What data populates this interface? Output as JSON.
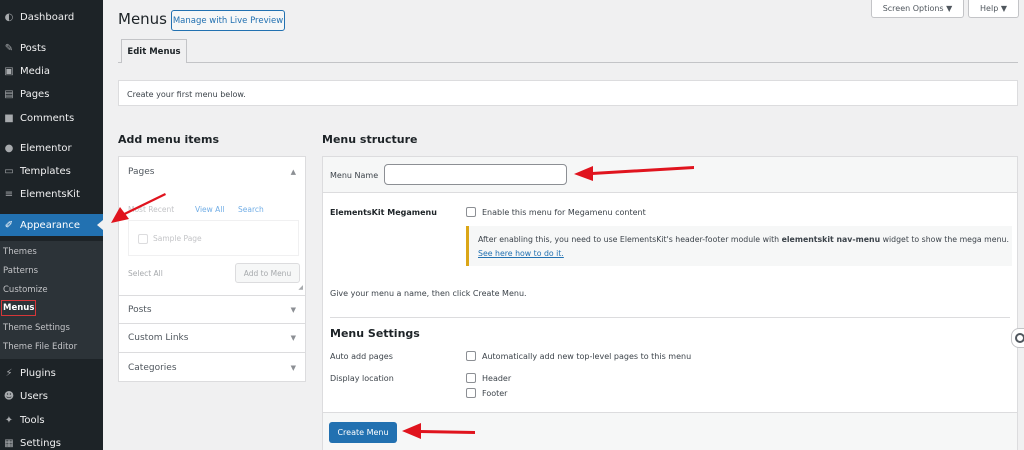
{
  "sidebar": {
    "items": [
      {
        "label": "Dashboard",
        "icon": "dashboard-icon"
      },
      {
        "label": "Posts",
        "icon": "pin-icon"
      },
      {
        "label": "Media",
        "icon": "media-icon"
      },
      {
        "label": "Pages",
        "icon": "pages-icon"
      },
      {
        "label": "Comments",
        "icon": "comments-icon"
      },
      {
        "label": "Elementor",
        "icon": "elementor-icon"
      },
      {
        "label": "Templates",
        "icon": "folder-icon"
      },
      {
        "label": "ElementsKit",
        "icon": "elementskit-icon"
      },
      {
        "label": "Appearance",
        "icon": "brush-icon"
      },
      {
        "label": "Plugins",
        "icon": "plugin-icon"
      },
      {
        "label": "Users",
        "icon": "user-icon"
      },
      {
        "label": "Tools",
        "icon": "wrench-icon"
      },
      {
        "label": "Settings",
        "icon": "settings-icon"
      }
    ],
    "submenu": [
      "Themes",
      "Patterns",
      "Customize",
      "Menus",
      "Theme Settings",
      "Theme File Editor"
    ]
  },
  "header": {
    "title": "Menus",
    "live_preview": "Manage with Live Preview",
    "screen_options": "Screen Options ▼",
    "help": "Help ▼",
    "tab": "Edit Menus"
  },
  "notice": "Create your first menu below.",
  "add_items": {
    "heading": "Add menu items",
    "pages": "Pages",
    "tabs": [
      "Most Recent",
      "View All",
      "Search"
    ],
    "sample_page": "Sample Page",
    "select_all": "Select All",
    "add_to_menu": "Add to Menu",
    "posts": "Posts",
    "custom_links": "Custom Links",
    "categories": "Categories"
  },
  "structure": {
    "heading": "Menu structure",
    "menu_name_label": "Menu Name",
    "menu_name_value": "",
    "megamenu_label": "ElementsKit Megamenu",
    "megamenu_option": "Enable this menu for Megamenu content",
    "info_pre": "After enabling this, you need to use ElementsKit's header-footer module with ",
    "info_bold": "elementskit nav-menu",
    "info_post": " widget to show the mega menu.",
    "info_link": "See here how to do it.",
    "hint": "Give your menu a name, then click Create Menu.",
    "settings_heading": "Menu Settings",
    "auto_add_label": "Auto add pages",
    "auto_add_option": "Automatically add new top-level pages to this menu",
    "display_location_label": "Display location",
    "locations": [
      "Header",
      "Footer"
    ],
    "create_button": "Create Menu"
  },
  "colors": {
    "sidebar_bg": "#1d2327",
    "accent": "#2271b1",
    "arrow": "#e0141e"
  }
}
